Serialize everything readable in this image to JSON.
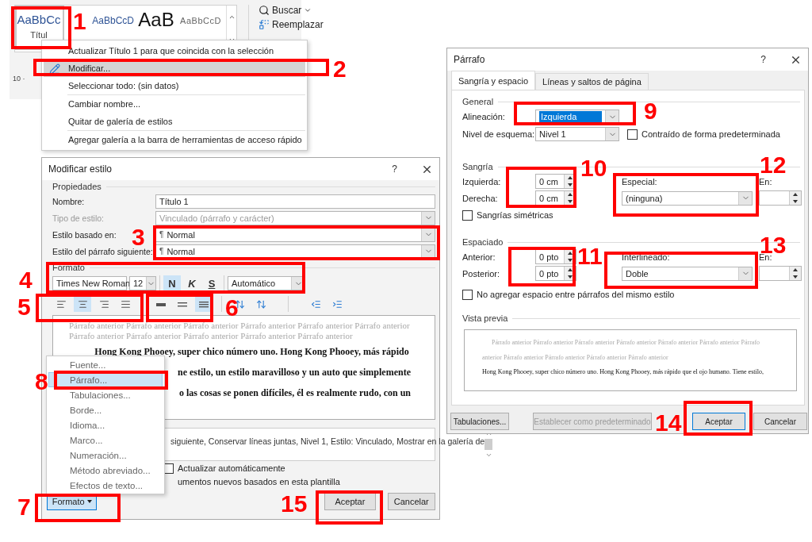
{
  "ribbon": {
    "styles": [
      {
        "sample": "AaBbCc",
        "label": "Títul",
        "selected": true,
        "kind": "heading"
      },
      {
        "sample": "AaBbCcD",
        "selected": false,
        "kind": "heading"
      },
      {
        "sample": "AaB",
        "selected": false,
        "kind": "title"
      },
      {
        "sample": "AaBbCcD",
        "selected": false,
        "kind": "subtle"
      }
    ],
    "editing": [
      {
        "label": "Buscar"
      },
      {
        "label": "Reemplazar"
      }
    ],
    "ruler": "10 ·"
  },
  "context_menu": {
    "items": [
      {
        "label": "Actualizar Título 1 para que coincida con la selección",
        "selected": false
      },
      {
        "label": "Modificar...",
        "selected": true
      },
      {
        "label": "Seleccionar todo: (sin datos)",
        "selected": false
      },
      {
        "label": "Cambiar nombre...",
        "selected": false
      },
      {
        "label": "Quitar de galería de estilos",
        "selected": false
      },
      {
        "label": "Agregar galería a la barra de herramientas de acceso rápido",
        "selected": false
      }
    ]
  },
  "modify_dialog": {
    "title": "Modificar estilo",
    "help": "?",
    "properties": {
      "heading": "Propiedades",
      "fields": [
        {
          "label": "Nombre:",
          "value": "Título 1",
          "kind": "text",
          "disabled": false
        },
        {
          "label": "Tipo de estilo:",
          "value": "Vinculado (párrafo y carácter)",
          "kind": "dropdown",
          "disabled": true
        },
        {
          "label": "Estilo basado en:",
          "symbol": "¶",
          "value": "Normal",
          "kind": "dropdown",
          "disabled": false
        },
        {
          "label": "Estilo del párrafo siguiente:",
          "symbol": "¶",
          "value": "Normal",
          "kind": "dropdown",
          "disabled": false
        }
      ]
    },
    "format": {
      "heading": "Formato",
      "font": "Times New Roman",
      "size": "12",
      "styles": [
        {
          "label": "N",
          "selected": true
        },
        {
          "label": "K",
          "selected": false
        },
        {
          "label": "S",
          "selected": false
        }
      ],
      "font_color": "Automático",
      "alignment": [
        {
          "selected": false
        },
        {
          "selected": true
        },
        {
          "selected": false
        },
        {
          "selected": false
        }
      ],
      "spacing": [
        {
          "selected": false
        },
        {
          "selected": false
        },
        {
          "selected": true
        }
      ]
    },
    "preview": {
      "previous_lines": [
        "Párrafo anterior Párrafo anterior Párrafo anterior Párrafo anterior Párrafo anterior Párrafo anterior",
        "Párrafo anterior Párrafo anterior Párrafo anterior Párrafo anterior Párrafo anterior"
      ],
      "lines": [
        "Hong Kong Phooey, super chico número uno. Hong Kong Phooey, más rápido",
        "ne estilo, un estilo maravilloso y un auto que simplemente",
        "o las cosas se ponen difíciles, él es realmente rudo, con un"
      ]
    },
    "description": "siguiente, Conservar líneas juntas, Nivel 1, Estilo: Vinculado, Mostrar en la galería de",
    "auto_update": {
      "label": "Actualizar automáticamente",
      "checked": false
    },
    "template_option": "umentos nuevos basados en esta plantilla",
    "buttons": [
      {
        "label": "Formato",
        "kind": "menu",
        "selected": true
      },
      {
        "label": "Aceptar",
        "kind": "plain",
        "selected": false
      },
      {
        "label": "Cancelar",
        "kind": "plain",
        "selected": false
      }
    ]
  },
  "format_menu": {
    "items": [
      {
        "label": "Fuente...",
        "selected": false
      },
      {
        "label": "Párrafo...",
        "selected": true
      },
      {
        "label": "Tabulaciones...",
        "selected": false
      },
      {
        "label": "Borde...",
        "selected": false
      },
      {
        "label": "Idioma...",
        "selected": false
      },
      {
        "label": "Marco...",
        "selected": false
      },
      {
        "label": "Numeración...",
        "selected": false
      },
      {
        "label": "Método abreviado...",
        "selected": false
      },
      {
        "label": "Efectos de texto...",
        "selected": false
      }
    ]
  },
  "paragraph_dialog": {
    "title": "Párrafo",
    "help": "?",
    "tabs": [
      {
        "label": "Sangría y espacio",
        "selected": true
      },
      {
        "label": "Líneas y saltos de página",
        "selected": false
      }
    ],
    "general": {
      "heading": "General",
      "alignment_label": "Alineación:",
      "alignment": "Izquierda",
      "outline_label": "Nivel de esquema:",
      "outline": "Nivel 1",
      "collapsed": {
        "label": "Contraído de forma predeterminada",
        "checked": false
      }
    },
    "indent": {
      "heading": "Sangría",
      "left_label": "Izquierda:",
      "left": "0 cm",
      "right_label": "Derecha:",
      "right": "0 cm",
      "special_label": "Especial:",
      "special": "(ninguna)",
      "by_label": "En:",
      "mirror": {
        "label": "Sangrías simétricas",
        "checked": false
      }
    },
    "spacing": {
      "heading": "Espaciado",
      "before_label": "Anterior:",
      "before": "0 pto",
      "after_label": "Posterior:",
      "after": "0 pto",
      "line_label": "Interlineado:",
      "line": "Doble",
      "at_label": "En:",
      "no_space": {
        "label": "No agregar espacio entre párrafos del mismo estilo",
        "checked": false
      }
    },
    "preview": {
      "heading": "Vista previa",
      "previous_lines": [
        "Párrafo anterior Párrafo anterior Párrafo anterior Párrafo anterior Párrafo anterior Párrafo anterior Párrafo",
        "anterior Párrafo anterior Párrafo anterior Párrafo anterior Párrafo anterior"
      ],
      "lines": [
        "Hong Kong Phooey, super chico número uno. Hong Kong Phooey, más rápido que el ojo humano. Tiene estilo,"
      ]
    },
    "buttons": [
      {
        "label": "Tabulaciones...",
        "disabled": false,
        "selected": false
      },
      {
        "label": "Establecer como predeterminado",
        "disabled": true,
        "selected": false
      },
      {
        "label": "Aceptar",
        "disabled": false,
        "selected": true
      },
      {
        "label": "Cancelar",
        "disabled": false,
        "selected": false
      }
    ]
  },
  "annotations": [
    {
      "number": "1"
    },
    {
      "number": "2"
    },
    {
      "number": "3"
    },
    {
      "number": "4"
    },
    {
      "number": "5"
    },
    {
      "number": "6"
    },
    {
      "number": "7"
    },
    {
      "number": "8"
    },
    {
      "number": "9"
    },
    {
      "number": "10"
    },
    {
      "number": "11"
    },
    {
      "number": "12"
    },
    {
      "number": "13"
    },
    {
      "number": "14"
    },
    {
      "number": "15"
    }
  ]
}
